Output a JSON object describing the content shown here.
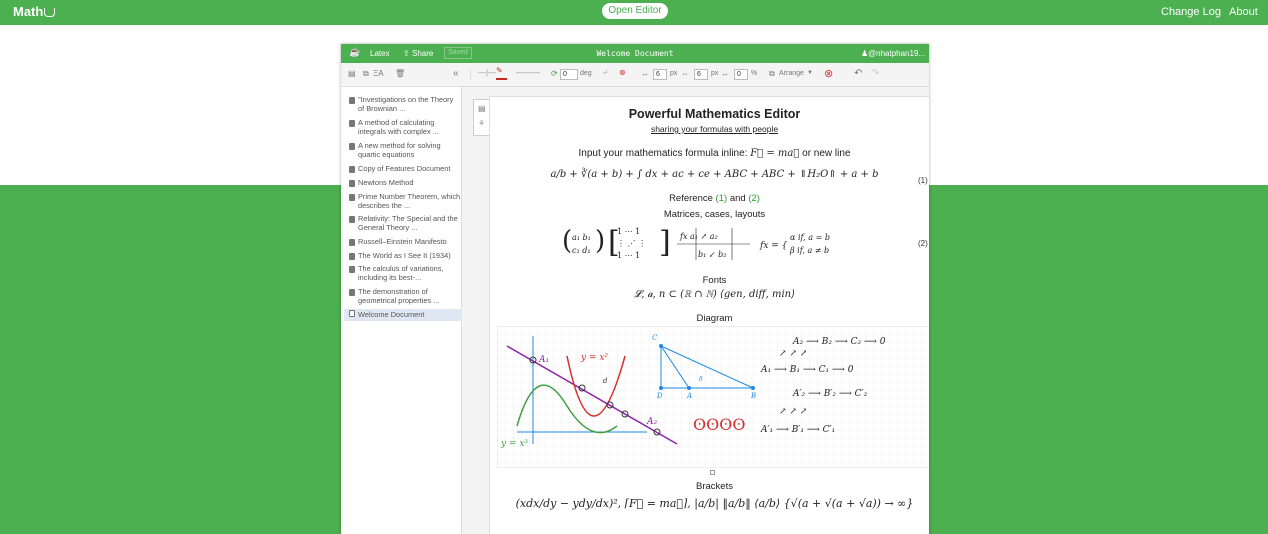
{
  "topbar": {
    "brand": "Math",
    "open_editor": "Open Editor",
    "change_log": "Change Log",
    "about": "About"
  },
  "window": {
    "latex_label": "Latex",
    "share_label": "Share",
    "saved_label": "Saved",
    "title": "Welcome Document",
    "user": "@nhatphan19..."
  },
  "toolbar": {
    "rotate_value": "0",
    "rotate_unit": "deg",
    "h_value": "6",
    "h_unit": "px",
    "v_value": "6",
    "v_unit": "px",
    "scale_value": "0",
    "scale_unit": "%",
    "arrange_label": "Arrange"
  },
  "sidebar": {
    "items": [
      {
        "label": "\"Investigations on the Theory of Brownian ..."
      },
      {
        "label": "A method of calculating integrals with complex ..."
      },
      {
        "label": "A new method for solving quartic equations"
      },
      {
        "label": "Copy of Features Document"
      },
      {
        "label": "Newtons Method"
      },
      {
        "label": "Prime Number Theorem, which describes the ..."
      },
      {
        "label": "Relativity: The Special and the General Theory ..."
      },
      {
        "label": "Russell–Einstein Manifesto"
      },
      {
        "label": "The World as I See It (1934)"
      },
      {
        "label": "The calculus of variations, including its best-..."
      },
      {
        "label": "The demonstration of geometrical properties ..."
      },
      {
        "label": "Welcome Document"
      }
    ]
  },
  "document": {
    "heading": "Powerful Mathematics Editor",
    "subheading": "sharing your formulas with people",
    "inline_intro": "Input your mathematics formula inline:",
    "inline_suffix": "or new line",
    "eq1_number": "(1)",
    "reference_prefix": "Reference",
    "ref1": "(1)",
    "ref_and": "and",
    "ref2": "(2)",
    "matrices_heading": "Matrices, cases, layouts",
    "eq2_number": "(2)",
    "fonts_heading": "Fonts",
    "fonts_formula": "𝓛, 𝒂, n ⊂ (ℝ ∩ ℕ) ⟨gen, diff, min⟩",
    "diagram_heading": "Diagram",
    "brackets_heading": "Brackets"
  },
  "colors": {
    "brand_green": "#4caf50",
    "link_green": "#2e9e3a",
    "diagram_red": "#d32f2f",
    "diagram_purple": "#8e24aa",
    "diagram_blue": "#1e88e5"
  }
}
